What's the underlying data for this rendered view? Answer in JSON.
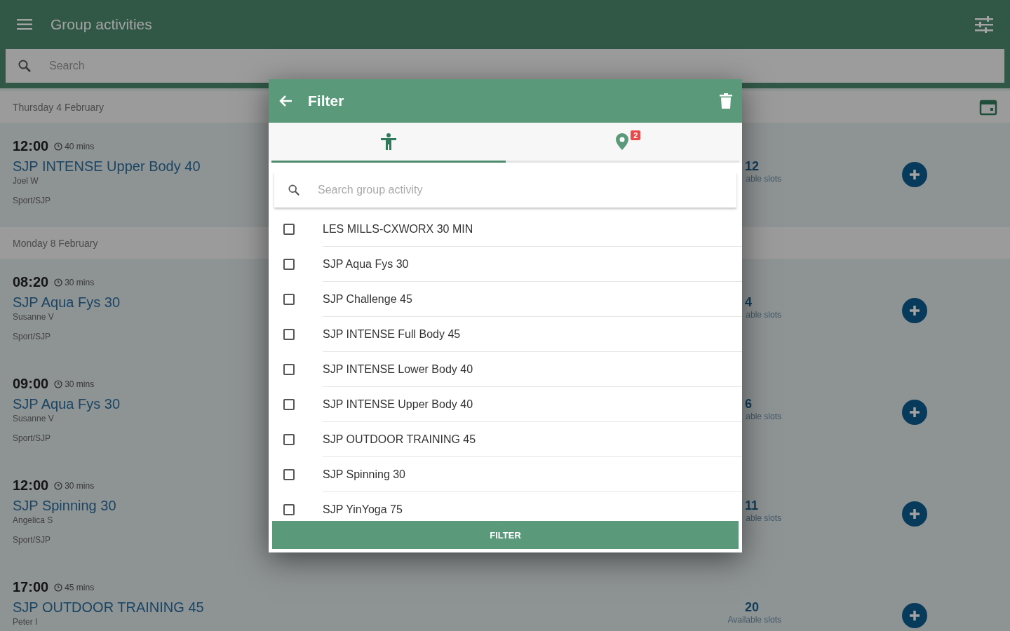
{
  "app_bar": {
    "title": "Group activities"
  },
  "search": {
    "placeholder": "Search"
  },
  "days": [
    {
      "date": "Thursday 4 February",
      "sessions": [
        {
          "time": "12:00",
          "duration": "40 mins",
          "title": "SJP INTENSE Upper Body 40",
          "instructor": "Joel W",
          "location": "Sport/SJP",
          "slots": "12",
          "slots_label": "able slots"
        }
      ]
    },
    {
      "date": "Monday 8 February",
      "sessions": [
        {
          "time": "08:20",
          "duration": "30 mins",
          "title": "SJP Aqua Fys 30",
          "instructor": "Susanne V",
          "location": "Sport/SJP",
          "slots": "4",
          "slots_label": "able slots"
        },
        {
          "time": "09:00",
          "duration": "30 mins",
          "title": "SJP Aqua Fys 30",
          "instructor": "Susanne V",
          "location": "Sport/SJP",
          "slots": "6",
          "slots_label": "able slots"
        },
        {
          "time": "12:00",
          "duration": "30 mins",
          "title": "SJP Spinning 30",
          "instructor": "Angelica S",
          "location": "Sport/SJP",
          "slots": "11",
          "slots_label": "able slots"
        },
        {
          "time": "17:00",
          "duration": "45 mins",
          "title": "SJP OUTDOOR TRAINING 45",
          "instructor": "Peter I",
          "slots": "20",
          "slots_label": "Available slots"
        }
      ]
    }
  ],
  "filter_dialog": {
    "title": "Filter",
    "tabs": [
      {
        "kind": "activity",
        "selected": true
      },
      {
        "kind": "location",
        "selected": false,
        "badge": "2"
      }
    ],
    "search": {
      "placeholder": "Search group activity"
    },
    "activities": [
      {
        "label": "LES MILLS-CXWORX 30 MIN",
        "checked": false
      },
      {
        "label": "SJP Aqua Fys 30",
        "checked": false
      },
      {
        "label": "SJP Challenge 45",
        "checked": false
      },
      {
        "label": "SJP INTENSE Full Body 45",
        "checked": false
      },
      {
        "label": "SJP INTENSE Lower Body 40",
        "checked": false
      },
      {
        "label": "SJP INTENSE Upper Body 40",
        "checked": false
      },
      {
        "label": "SJP OUTDOOR TRAINING 45",
        "checked": false
      },
      {
        "label": "SJP Spinning 30",
        "checked": false
      },
      {
        "label": "SJP YinYoga 75",
        "checked": false
      }
    ],
    "button": "FILTER"
  }
}
